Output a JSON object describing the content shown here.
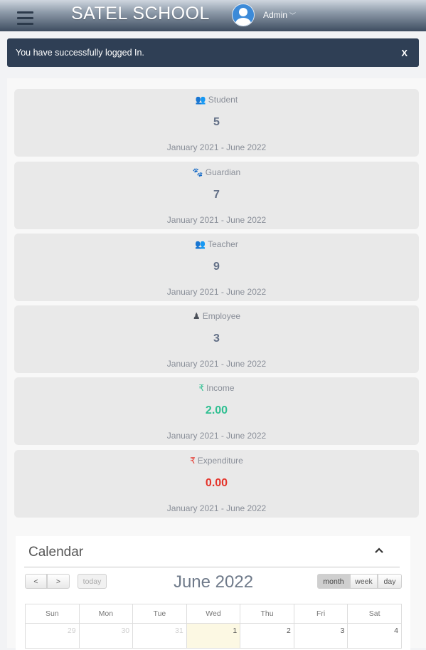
{
  "header": {
    "brand": "SATEL SCHOOL",
    "user_name": "Admin"
  },
  "alert": {
    "message": "You have successfully logged In.",
    "close_label": "X"
  },
  "cards": [
    {
      "label": "Student",
      "value": "5",
      "period": "January 2021 - June 2022",
      "icon": "users-icon",
      "icon_glyph": "👥"
    },
    {
      "label": "Guardian",
      "value": "7",
      "period": "January 2021 - June 2022",
      "icon": "paw-icon",
      "icon_glyph": "🐾"
    },
    {
      "label": "Teacher",
      "value": "9",
      "period": "January 2021 - June 2022",
      "icon": "users-icon",
      "icon_glyph": "👥"
    },
    {
      "label": "Employee",
      "value": "3",
      "period": "January 2021 - June 2022",
      "icon": "sitemap-icon",
      "icon_glyph": "♟"
    },
    {
      "label": "Income",
      "value": "2.00",
      "period": "January 2021 - June 2022",
      "icon": "rupee-icon",
      "icon_glyph": "₹"
    },
    {
      "label": "Expenditure",
      "value": "0.00",
      "period": "January 2021 - June 2022",
      "icon": "rupee-icon",
      "icon_glyph": "₹"
    }
  ],
  "colors": {
    "income": "#2ebf91",
    "expenditure": "#e5332a",
    "alert_bg": "#2f3f55",
    "value_default": "#637087"
  },
  "calendar": {
    "title": "Calendar",
    "month_title": "June 2022",
    "prev_label": "<",
    "next_label": ">",
    "today_label": "today",
    "views": [
      "month",
      "week",
      "day"
    ],
    "active_view": "month",
    "weekdays": [
      "Sun",
      "Mon",
      "Tue",
      "Wed",
      "Thu",
      "Fri",
      "Sat"
    ],
    "first_row": [
      "29",
      "30",
      "31",
      "1",
      "2",
      "3",
      "4"
    ]
  }
}
